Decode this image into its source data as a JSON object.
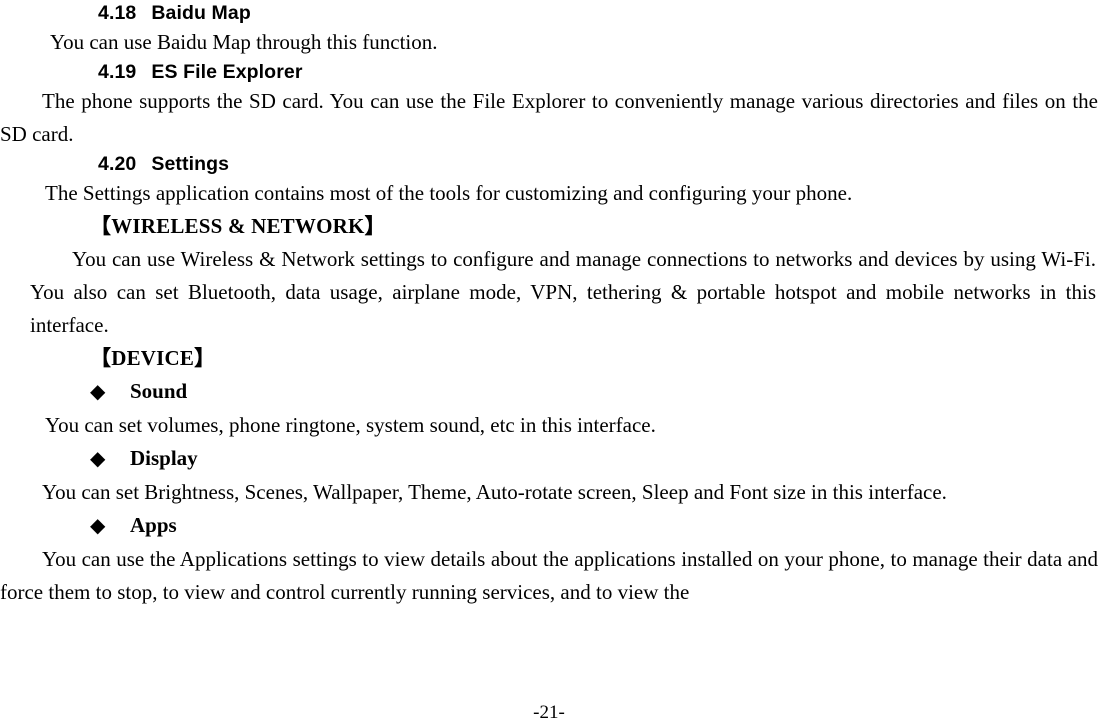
{
  "page": {
    "number_label": "-21-"
  },
  "sections": {
    "baidu_map": {
      "number": "4.18",
      "title": "Baidu Map",
      "body": "You can use Baidu Map through this function."
    },
    "es_file_explorer": {
      "number": "4.19",
      "title": "ES File Explorer",
      "body": "The phone supports the SD card. You can use the File Explorer to conveniently manage various directories and files on the SD card."
    },
    "settings": {
      "number": "4.20",
      "title": "Settings",
      "intro": "The Settings application contains most of the tools for customizing and configuring your phone.",
      "groups": [
        {
          "label": "【WIRELESS & NETWORK】",
          "body": "You can use Wireless & Network settings to configure and manage connections to networks and devices by using Wi-Fi. You also can set Bluetooth, data usage, airplane mode, VPN, tethering & portable hotspot and mobile networks in this interface."
        },
        {
          "label": "【DEVICE】",
          "items": [
            {
              "bullet": "◆",
              "title": "Sound",
              "body": "You can set volumes, phone ringtone, system sound, etc in this interface."
            },
            {
              "bullet": "◆",
              "title": "Display",
              "body": "You can set Brightness, Scenes, Wallpaper, Theme, Auto-rotate screen, Sleep and Font size in this interface."
            },
            {
              "bullet": "◆",
              "title": "Apps",
              "body": "You can use the Applications settings to view details about the applications installed on your phone, to manage their data and force them to stop, to view and control currently running services, and to view the"
            }
          ]
        }
      ]
    }
  }
}
